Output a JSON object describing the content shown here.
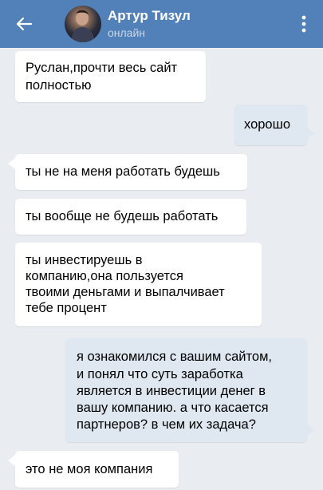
{
  "header": {
    "title": "Артур Тизул",
    "status": "онлайн",
    "back_icon": "arrow-left-icon",
    "menu_icon": "more-vertical-icon",
    "bg_color": "#5181b8"
  },
  "messages": [
    {
      "direction": "in",
      "lines": [
        "Руслан,прочти весь сайт",
        "полностью"
      ]
    },
    {
      "direction": "out",
      "lines": [
        "хорошо"
      ]
    },
    {
      "direction": "in",
      "lines": [
        "ты не на меня работать будешь"
      ]
    },
    {
      "direction": "in",
      "lines": [
        "ты вообще не будешь работать"
      ]
    },
    {
      "direction": "in",
      "lines": [
        "ты инвестируешь в",
        "компанию,она пользуется",
        "твоими деньгами и выпалчивает",
        "тебе процент"
      ]
    },
    {
      "direction": "out",
      "lines": [
        "я ознакомился с вашим сайтом,",
        "и понял что суть заработка",
        "является в инвестиции денег в",
        "вашу компанию. а что касается",
        "партнеров? в чем их задача?"
      ]
    },
    {
      "direction": "in",
      "lines": [
        "это не моя компания"
      ]
    }
  ]
}
